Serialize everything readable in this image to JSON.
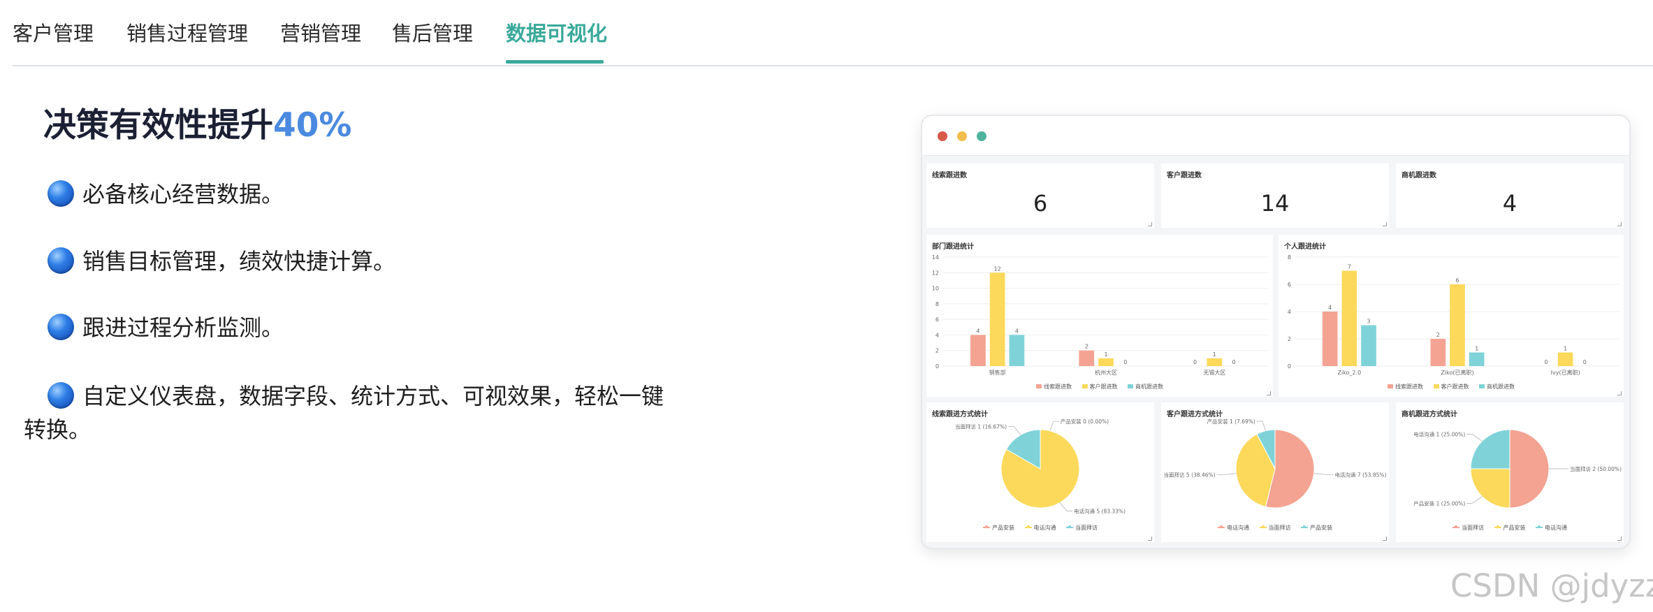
{
  "tabs": [
    {
      "label": "客户管理"
    },
    {
      "label": "销售过程管理"
    },
    {
      "label": "营销管理"
    },
    {
      "label": "售后管理"
    },
    {
      "label": "数据可视化",
      "active": true
    }
  ],
  "headline": {
    "text": "决策有效性提升",
    "accent": "40%"
  },
  "bullets": [
    {
      "text": "必备核心经营数据。"
    },
    {
      "text": "销售目标管理，绩效快捷计算。"
    },
    {
      "text": "跟进过程分析监测。"
    },
    {
      "text": "自定义仪表盘，数据字段、统计方式、可视效果，轻松一键",
      "text2": "转换。"
    }
  ],
  "colors": {
    "accent": "#3aa99a",
    "headline_accent": "#4a8ae0",
    "salmon": "#f4a392",
    "yellow": "#fcd95b",
    "cyan": "#7fd3d8"
  },
  "dashboard": {
    "kpis": [
      {
        "title": "线索跟进数",
        "value": "6"
      },
      {
        "title": "客户跟进数",
        "value": "14"
      },
      {
        "title": "商机跟进数",
        "value": "4"
      }
    ],
    "pie_legends": [
      [
        "产品安装",
        "电话沟通",
        "当面拜访"
      ],
      [
        "电话沟通",
        "当面拜访",
        "产品安装"
      ],
      [
        "当面拜访",
        "产品安装",
        "电话沟通"
      ]
    ]
  },
  "chart_data": [
    {
      "type": "bar",
      "title": "部门跟进统计",
      "categories": [
        "销售部",
        "杭州大区",
        "无锡大区"
      ],
      "series": [
        {
          "name": "线索跟进数",
          "values": [
            4,
            2,
            0
          ]
        },
        {
          "name": "客户跟进数",
          "values": [
            12,
            1,
            1
          ]
        },
        {
          "name": "商机跟进数",
          "values": [
            4,
            0,
            0
          ]
        }
      ],
      "ylim": [
        0,
        14
      ],
      "yticks": [
        "0",
        "2",
        "4",
        "6",
        "8",
        "10",
        "12",
        "14"
      ],
      "grid": true,
      "legend": "bottom"
    },
    {
      "type": "bar",
      "title": "个人跟进统计",
      "categories": [
        "Ziko_2.0",
        "Ziko(已离职)",
        "Ivy(已离职)"
      ],
      "series": [
        {
          "name": "线索跟进数",
          "values": [
            4,
            2,
            0
          ]
        },
        {
          "name": "客户跟进数",
          "values": [
            7,
            6,
            1
          ]
        },
        {
          "name": "商机跟进数",
          "values": [
            3,
            1,
            0
          ]
        }
      ],
      "ylim": [
        0,
        8
      ],
      "yticks": [
        "0",
        "2",
        "4",
        "6",
        "8"
      ],
      "grid": true,
      "legend": "bottom"
    },
    {
      "type": "pie",
      "title": "线索跟进方式统计",
      "slices": [
        {
          "label": "产品安装 0 (0.00%)",
          "value": 0,
          "color": "#f4a392"
        },
        {
          "label": "电话沟通 5 (83.33%)",
          "value": 5,
          "color": "#fcd95b"
        },
        {
          "label": "当面拜访 1 (16.67%)",
          "value": 1,
          "color": "#7fd3d8"
        }
      ],
      "legend": "bottom"
    },
    {
      "type": "pie",
      "title": "客户跟进方式统计",
      "slices": [
        {
          "label": "电话沟通 7 (53.85%)",
          "value": 7,
          "color": "#f4a392"
        },
        {
          "label": "当面拜访 5 (38.46%)",
          "value": 5,
          "color": "#fcd95b"
        },
        {
          "label": "产品安装 1 (7.69%)",
          "value": 1,
          "color": "#7fd3d8"
        }
      ],
      "legend": "bottom"
    },
    {
      "type": "pie",
      "title": "商机跟进方式统计",
      "slices": [
        {
          "label": "当面拜访 2 (50.00%)",
          "value": 2,
          "color": "#f4a392"
        },
        {
          "label": "产品安装 1 (25.00%)",
          "value": 1,
          "color": "#fcd95b"
        },
        {
          "label": "电话沟通 1 (25.00%)",
          "value": 1,
          "color": "#7fd3d8"
        }
      ],
      "legend": "bottom"
    }
  ],
  "watermark": "CSDN @jdyzzy"
}
